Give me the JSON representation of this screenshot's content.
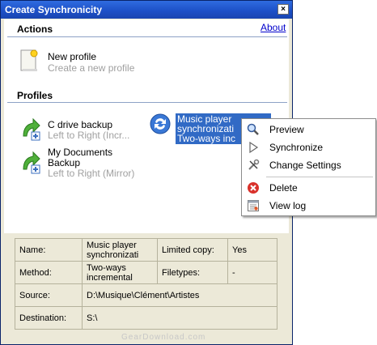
{
  "window": {
    "title": "Create Synchronicity",
    "close_glyph": "×"
  },
  "actions": {
    "heading": "Actions",
    "about_link": "About",
    "new_profile": {
      "title": "New profile",
      "subtitle": "Create a new profile",
      "icon": "new-document-icon"
    }
  },
  "profiles": {
    "heading": "Profiles",
    "items": [
      {
        "line1": "C drive backup",
        "line2": "Left to Right (Incr...",
        "icon": "green-arrow-plus-icon"
      },
      {
        "line1": "My Documents",
        "line1b": "Backup",
        "line2": "Left to Right (Mirror)",
        "icon": "green-arrow-plus-icon"
      },
      {
        "line1": "Music player",
        "line1b": "synchronizati",
        "line2": "Two-ways inc",
        "icon": "two-way-sync-icon",
        "selected": true
      }
    ]
  },
  "context_menu": {
    "items": [
      {
        "label": "Preview",
        "icon": "magnifier-icon"
      },
      {
        "label": "Synchronize",
        "icon": "play-icon"
      },
      {
        "label": "Change Settings",
        "icon": "tools-icon"
      },
      {
        "label": "Delete",
        "icon": "delete-icon"
      },
      {
        "label": "View log",
        "icon": "log-icon"
      }
    ]
  },
  "details": {
    "name_label": "Name:",
    "name_value_1": "Music player",
    "name_value_2": "synchronizati",
    "limited_label": "Limited copy:",
    "limited_value": "Yes",
    "method_label": "Method:",
    "method_value_1": "Two-ways",
    "method_value_2": "incremental",
    "filetypes_label": "Filetypes:",
    "filetypes_value": "-",
    "source_label": "Source:",
    "source_value": "D:\\Musique\\Clément\\Artistes",
    "destination_label": "Destination:",
    "destination_value": "S:\\"
  },
  "watermark": "GearDownload.com",
  "colors": {
    "selection": "#316ac5",
    "titlebar": "#1c4fc6",
    "link": "#0000cc"
  }
}
